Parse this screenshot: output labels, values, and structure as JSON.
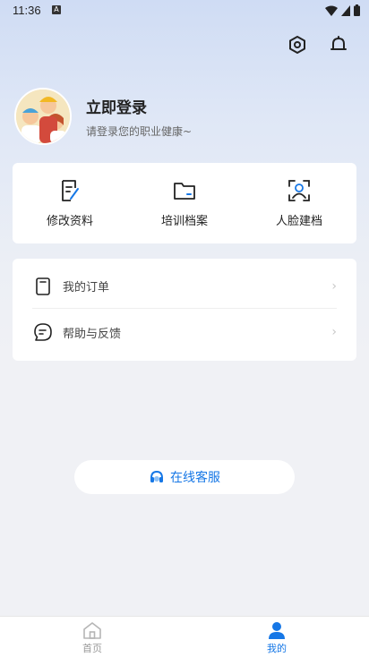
{
  "status_bar": {
    "time": "11:36",
    "app_icon_letter": "A"
  },
  "profile": {
    "title": "立即登录",
    "subtitle": "请登录您的职业健康~"
  },
  "actions": [
    {
      "label": "修改资料",
      "icon": "edit-document-icon"
    },
    {
      "label": "培训档案",
      "icon": "folder-icon"
    },
    {
      "label": "人脸建档",
      "icon": "face-scan-icon"
    }
  ],
  "menu": [
    {
      "label": "我的订单",
      "icon": "order-icon"
    },
    {
      "label": "帮助与反馈",
      "icon": "feedback-icon"
    }
  ],
  "service": {
    "label": "在线客服",
    "icon": "headset-icon"
  },
  "tabs": [
    {
      "label": "首页",
      "icon": "home-icon",
      "active": false
    },
    {
      "label": "我的",
      "icon": "person-icon",
      "active": true
    }
  ],
  "colors": {
    "accent": "#1677e6",
    "text": "#222222",
    "muted": "#9a9a9a"
  }
}
